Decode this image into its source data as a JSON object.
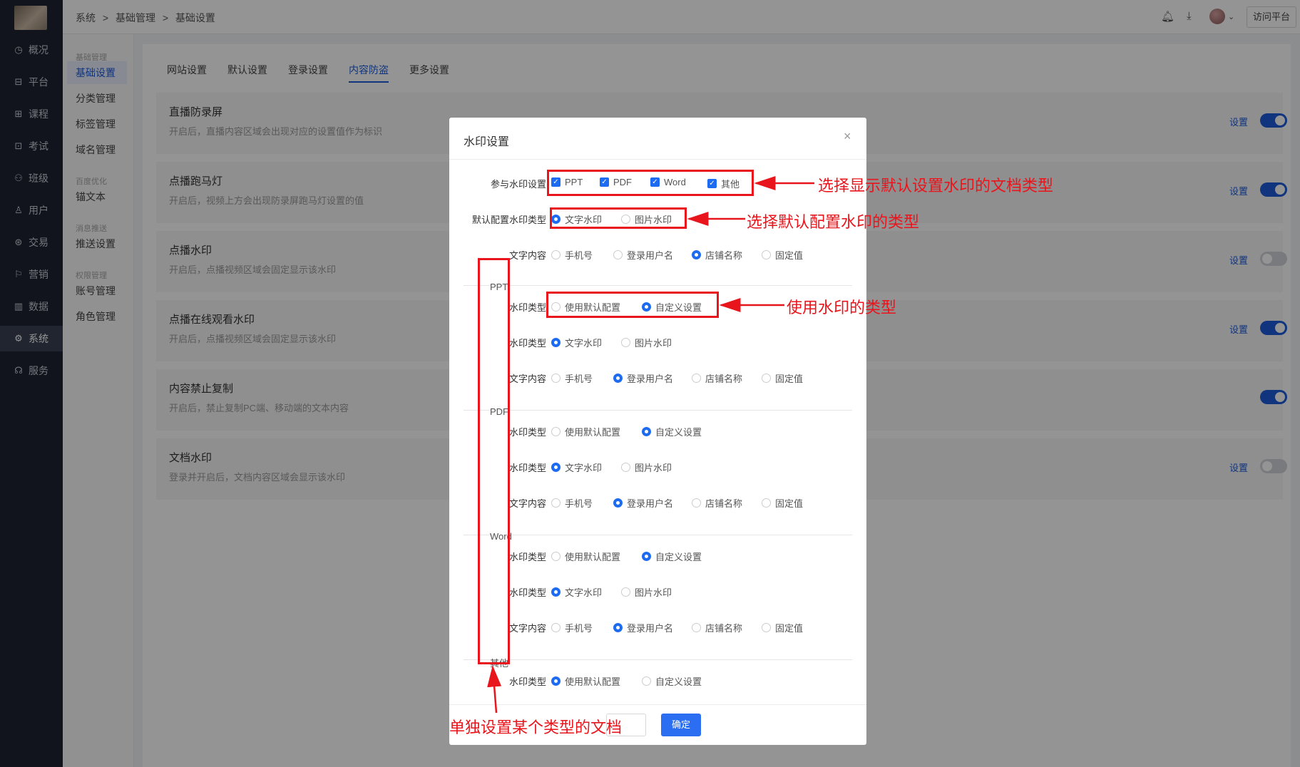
{
  "sidebar": {
    "items": [
      {
        "icon": "dashboard-icon",
        "glyph": "◷",
        "label": "概况"
      },
      {
        "icon": "platform-icon",
        "glyph": "⊟",
        "label": "平台"
      },
      {
        "icon": "course-icon",
        "glyph": "⊞",
        "label": "课程"
      },
      {
        "icon": "exam-icon",
        "glyph": "⊡",
        "label": "考试"
      },
      {
        "icon": "class-icon",
        "glyph": "⚇",
        "label": "班级"
      },
      {
        "icon": "user-icon",
        "glyph": "♙",
        "label": "用户"
      },
      {
        "icon": "trade-icon",
        "glyph": "⊛",
        "label": "交易"
      },
      {
        "icon": "marketing-icon",
        "glyph": "⚐",
        "label": "营销"
      },
      {
        "icon": "data-icon",
        "glyph": "▥",
        "label": "数据"
      },
      {
        "icon": "system-icon",
        "glyph": "⚙",
        "label": "系统"
      },
      {
        "icon": "service-icon",
        "glyph": "☊",
        "label": "服务"
      }
    ],
    "active_index": 9
  },
  "subnav": {
    "groups": [
      {
        "title": "基础管理",
        "items": [
          "基础设置",
          "分类管理",
          "标签管理",
          "域名管理"
        ]
      },
      {
        "title": "百度优化",
        "items": [
          "锚文本"
        ]
      },
      {
        "title": "消息推送",
        "items": [
          "推送设置"
        ]
      },
      {
        "title": "权限管理",
        "items": [
          "账号管理",
          "角色管理"
        ]
      }
    ],
    "active": "基础设置"
  },
  "breadcrumb": [
    "系统",
    ">",
    "基础管理",
    ">",
    "基础设置"
  ],
  "topbar": {
    "visit_label": "访问平台"
  },
  "tabs": {
    "items": [
      "网站设置",
      "默认设置",
      "登录设置",
      "内容防盗",
      "更多设置"
    ],
    "active": "内容防盗"
  },
  "cards": [
    {
      "title": "直播防录屏",
      "desc": "开启后，直播内容区域会出现对应的设置值作为标识",
      "link": "设置",
      "on": true
    },
    {
      "title": "点播跑马灯",
      "desc": "开启后，视频上方会出现防录屏跑马灯设置的值",
      "link": "设置",
      "on": true
    },
    {
      "title": "点播水印",
      "desc": "开启后，点播视频区域会固定显示该水印",
      "link": "设置",
      "on": false
    },
    {
      "title": "点播在线观看水印",
      "desc": "开启后，点播视频区域会固定显示该水印",
      "link": "设置",
      "on": true
    },
    {
      "title": "内容禁止复制",
      "desc": "开启后，禁止复制PC端、移动端的文本内容",
      "link": "",
      "on": true
    },
    {
      "title": "文档水印",
      "desc": "登录并开启后，文档内容区域会显示该水印",
      "link": "设置",
      "on": false
    }
  ],
  "modal": {
    "title": "水印设置",
    "close": "×",
    "participate_label": "参与水印设置",
    "participate_options": [
      "PPT",
      "PDF",
      "Word",
      "其他"
    ],
    "default_type_label": "默认配置水印类型",
    "type_options": [
      "文字水印",
      "图片水印"
    ],
    "content_label": "文字内容",
    "content_options": [
      "手机号",
      "登录用户名",
      "店铺名称",
      "固定值"
    ],
    "wm_type_label": "水印类型",
    "mode_options": [
      "使用默认配置",
      "自定义设置"
    ],
    "default_content_selected": 2,
    "sections": [
      {
        "name": "PPT",
        "mode": 1,
        "type": 0,
        "content": 1
      },
      {
        "name": "PDF",
        "mode": 1,
        "type": 0,
        "content": 1
      },
      {
        "name": "Word",
        "mode": 1,
        "type": 0,
        "content": 1
      },
      {
        "name": "其他",
        "mode": 0
      }
    ],
    "ok_label": "确定"
  },
  "annotations": {
    "doc_types": "选择显示默认设置水印的文档类型",
    "default_type": "选择默认配置水印的类型",
    "use_type": "使用水印的类型",
    "single": "单独设置某个类型的文档"
  },
  "colors": {
    "accent": "#1d5bd8",
    "annotation": "#e8151c",
    "sidebar": "#1f2433"
  }
}
